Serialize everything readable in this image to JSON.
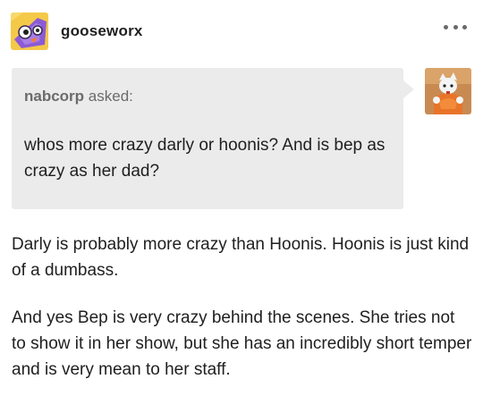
{
  "post": {
    "blog_name": "gooseworx",
    "blog_avatar_icon": "purple-character-avatar-icon",
    "more_icon": "more-options-icon"
  },
  "ask": {
    "asker_name": "nabcorp",
    "asked_label": "asked:",
    "question": "whos more crazy darly or hoonis? And is bep as crazy as her dad?",
    "asker_avatar_icon": "orange-character-avatar-icon"
  },
  "answer": {
    "paragraphs": [
      "Darly is probably more crazy than Hoonis. Hoonis is just kind of a dumbass.",
      "And yes Bep is very crazy behind the scenes. She tries not to show it in her show, but she has an incredibly short temper and is very mean to her staff."
    ]
  },
  "colors": {
    "bubble_background": "#ebebeb",
    "text": "#1f1f1f",
    "muted_text": "#6b6b6b"
  }
}
